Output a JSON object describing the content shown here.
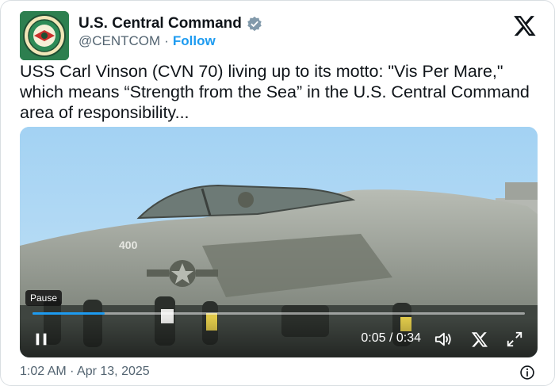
{
  "author": {
    "display_name": "U.S. Central Command",
    "handle": "@CENTCOM",
    "separator": "·",
    "follow_label": "Follow"
  },
  "tweet": {
    "text": "USS Carl Vinson (CVN 70) living up to its motto: \"Vis Per Mare,\" which means “Strength from the Sea” in the U.S. Central Command area of responsibility..."
  },
  "video": {
    "tooltip": "Pause",
    "time_display": "0:05 / 0:34",
    "progress_fraction": 0.147,
    "aircraft_number": "400"
  },
  "footer": {
    "timestamp": "1:02 AM · Apr 13, 2025"
  },
  "colors": {
    "accent": "#1d9bf0",
    "text": "#0f1419",
    "secondary": "#536471",
    "sky": "#a9d6f5"
  },
  "icons": [
    "centcom-seal",
    "verified-badge-icon",
    "x-logo-icon",
    "pause-icon",
    "volume-icon",
    "x-share-icon",
    "fullscreen-icon",
    "info-icon"
  ]
}
